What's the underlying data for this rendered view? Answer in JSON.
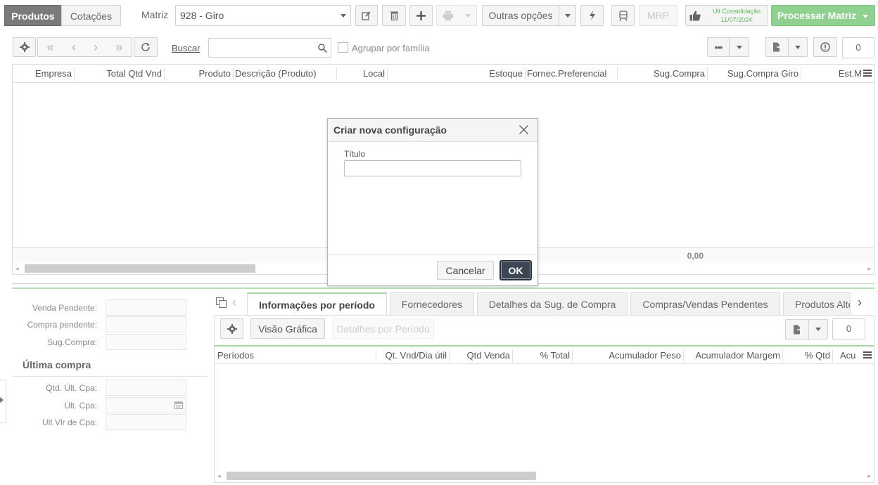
{
  "toolbar": {
    "tab_produtos": "Produtos",
    "tab_cotacoes": "Cotações",
    "matriz_label": "Matriz",
    "matriz_value": "928 - Giro",
    "outras_opcoes": "Outras opções",
    "mrp": "MRP",
    "ult_consolidacao_label": "Ult Consolidação",
    "ult_consolidacao_date": "11/07/2024",
    "processar": "Processar Matriz"
  },
  "grid_toolbar": {
    "buscar": "Buscar",
    "agrupar": "Agrupar por família",
    "count": "0"
  },
  "grid": {
    "columns": [
      "Empresa",
      "Total Qtd Vnd",
      "Produto",
      "Descrição (Produto)",
      "Local",
      "Estoque",
      "Fornec.Preferencial",
      "Sug.Compra",
      "Sug.Compra Giro",
      "Est.M"
    ],
    "footer_total": "0,00"
  },
  "dialog": {
    "title": "Criar nova configuração",
    "field_label": "Título",
    "field_value": "",
    "cancel": "Cancelar",
    "ok": "OK"
  },
  "left_panel": {
    "venda_pendente": "Venda Pendente:",
    "compra_pendente": "Compra pendente:",
    "sug_compra": "Sug.Compra:",
    "ultima_compra": "Última compra",
    "qtd_ult_cpa": "Qtd. Últ. Cpa:",
    "ult_cpa": "Últ. Cpa:",
    "ult_vlr_cpa": "Ult Vlr de Cpa:"
  },
  "bottom_tabs": [
    "Informações por período",
    "Fornecedores",
    "Detalhes da Sug. de Compra",
    "Compras/Vendas Pendentes",
    "Produtos Alte"
  ],
  "bottom_toolbar": {
    "visao_grafica": "Visão Gráfica",
    "detalhes_periodo": "Detalhes por Período",
    "count": "0"
  },
  "bottom_grid": {
    "columns": [
      "Períodos",
      "Qt. Vnd/Dia útil",
      "Qtd Venda",
      "% Total",
      "Acumulador Peso",
      "Acumulador Margem",
      "% Qtd",
      "Acu"
    ]
  },
  "colors": {
    "primary_green": "#8fd28f",
    "tab_active": "#7a7a7a",
    "ok_button": "#3d4654"
  }
}
